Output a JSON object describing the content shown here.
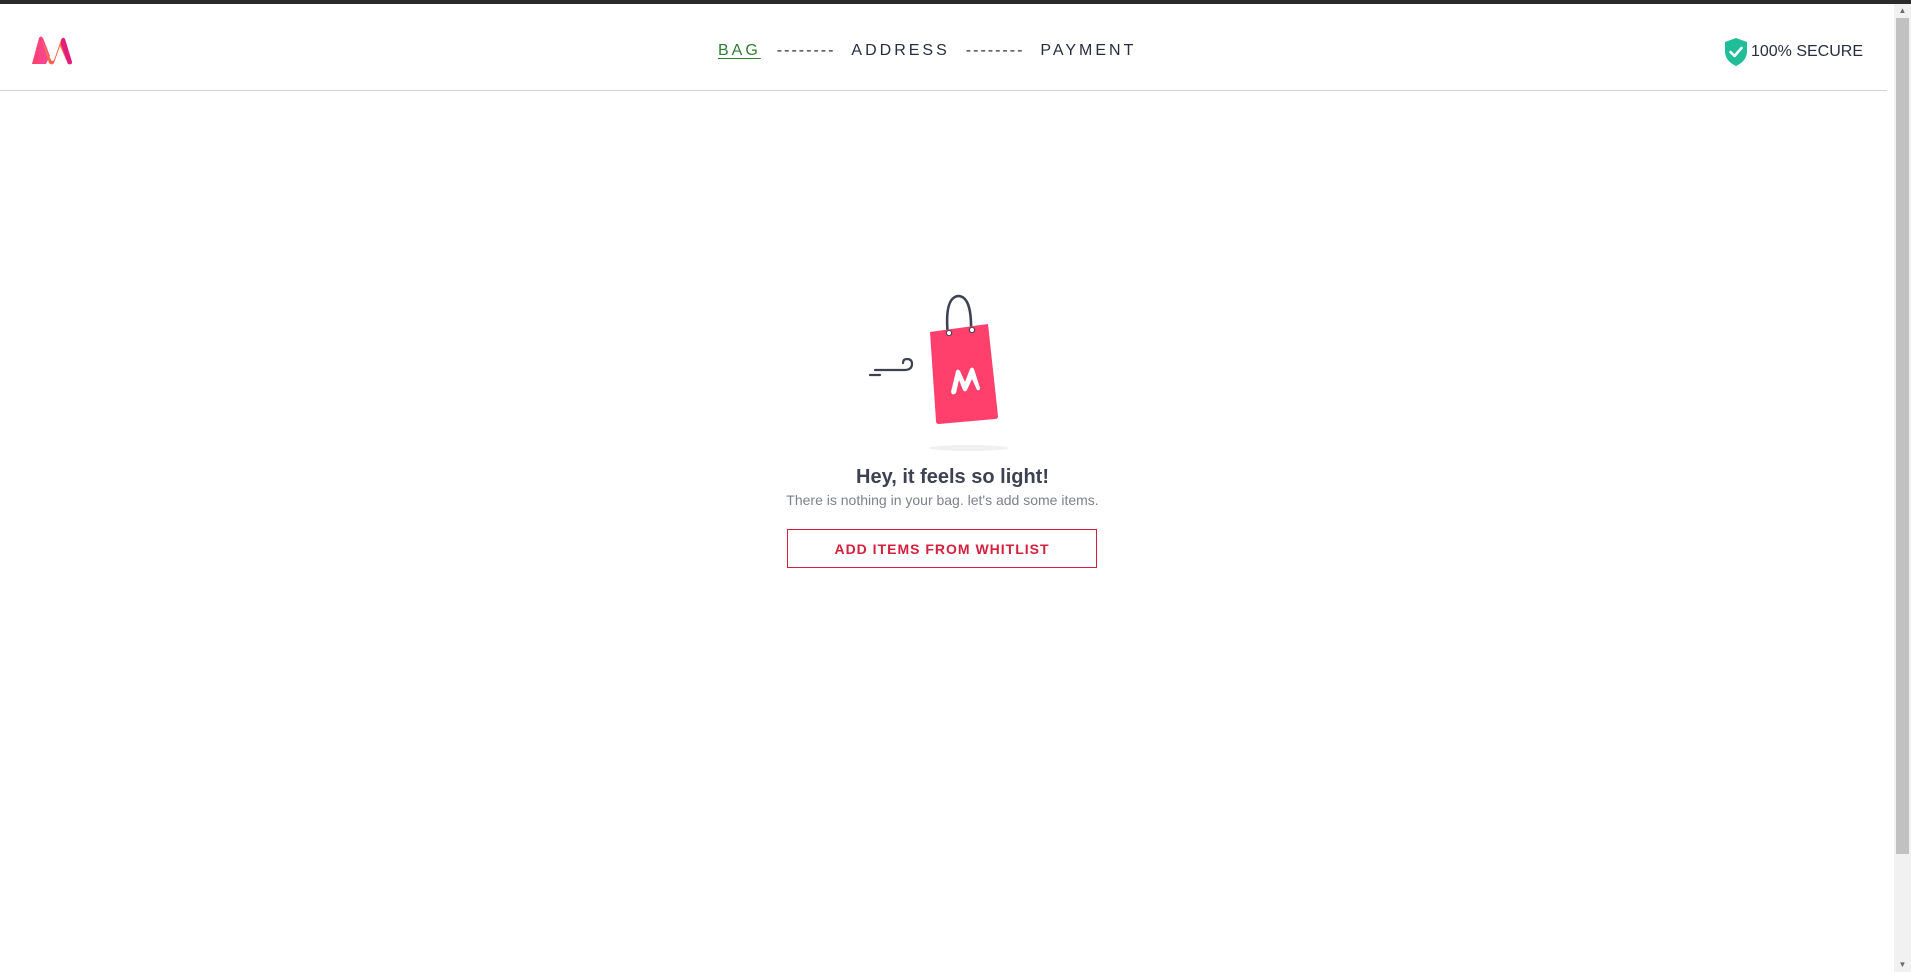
{
  "header": {
    "steps": [
      {
        "label": "BAG",
        "active": true
      },
      {
        "label": "ADDRESS",
        "active": false
      },
      {
        "label": "PAYMENT",
        "active": false
      }
    ],
    "separator": "--------",
    "secure_label": "100% SECURE"
  },
  "empty_bag": {
    "title": "Hey, it feels so light!",
    "message": "There is nothing in your bag. let's add some items.",
    "cta_label": "ADD ITEMS FROM WHITLIST"
  },
  "colors": {
    "brand_pink": "#ff3f6c",
    "cta_red": "#d4203d",
    "active_step": "#2e7d32",
    "secure_green": "#20bd99"
  },
  "icons": [
    "myntra-logo-icon",
    "shield-check-icon",
    "empty-bag-illustration"
  ]
}
